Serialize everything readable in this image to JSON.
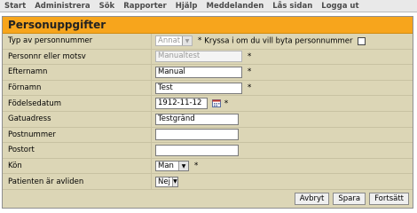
{
  "menu": [
    "Start",
    "Administrera",
    "Sök",
    "Rapporter",
    "Hjälp",
    "Meddelanden",
    "Lås sidan",
    "Logga ut"
  ],
  "title": "Personuppgifter",
  "required_mark": "*",
  "fields": {
    "typ": {
      "label": "Typ av personnummer",
      "value": "Annat",
      "note": "Kryssa i om du vill byta personnummer"
    },
    "personnr": {
      "label": "Personnr eller motsv",
      "value": "Manualtest"
    },
    "efternamn": {
      "label": "Efternamn",
      "value": "Manual"
    },
    "fornamn": {
      "label": "Förnamn",
      "value": "Test"
    },
    "fodelsedatum": {
      "label": "Födelsedatum",
      "value": "1912-11-12"
    },
    "gatuadress": {
      "label": "Gatuadress",
      "value": "Testgränd"
    },
    "postnummer": {
      "label": "Postnummer",
      "value": ""
    },
    "postort": {
      "label": "Postort",
      "value": ""
    },
    "kon": {
      "label": "Kön",
      "value": "Man"
    },
    "avliden": {
      "label": "Patienten är avliden",
      "value": "Nej"
    }
  },
  "buttons": {
    "cancel": "Avbryt",
    "save": "Spara",
    "continue": "Fortsätt"
  },
  "colors": {
    "header": "#f7a51c",
    "panel": "#dcd6b6",
    "menubar": "#e9e9e9"
  }
}
